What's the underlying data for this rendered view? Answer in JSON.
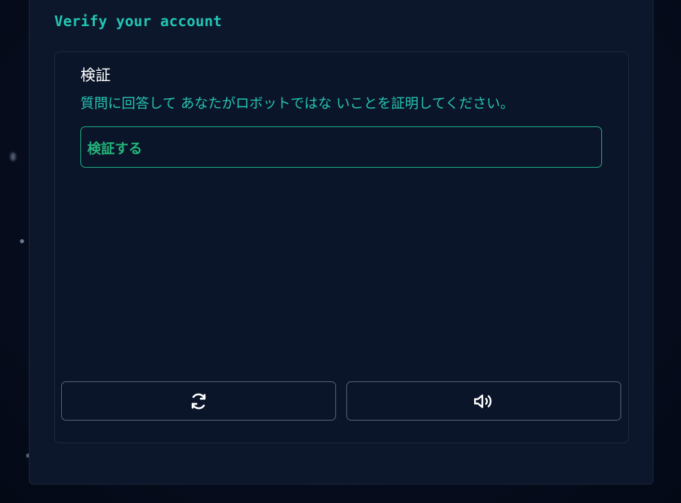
{
  "header": {
    "title": "Verify your account"
  },
  "challenge": {
    "heading": "検証",
    "description": "質問に回答して あなたがロボットではな いことを証明してください。",
    "verify_button_label": "検証する"
  },
  "controls": {
    "refresh_icon": "refresh-icon",
    "audio_icon": "speaker-icon"
  },
  "colors": {
    "accent": "#22c6b4",
    "button_green": "#22b67a",
    "background": "#0c172b"
  }
}
